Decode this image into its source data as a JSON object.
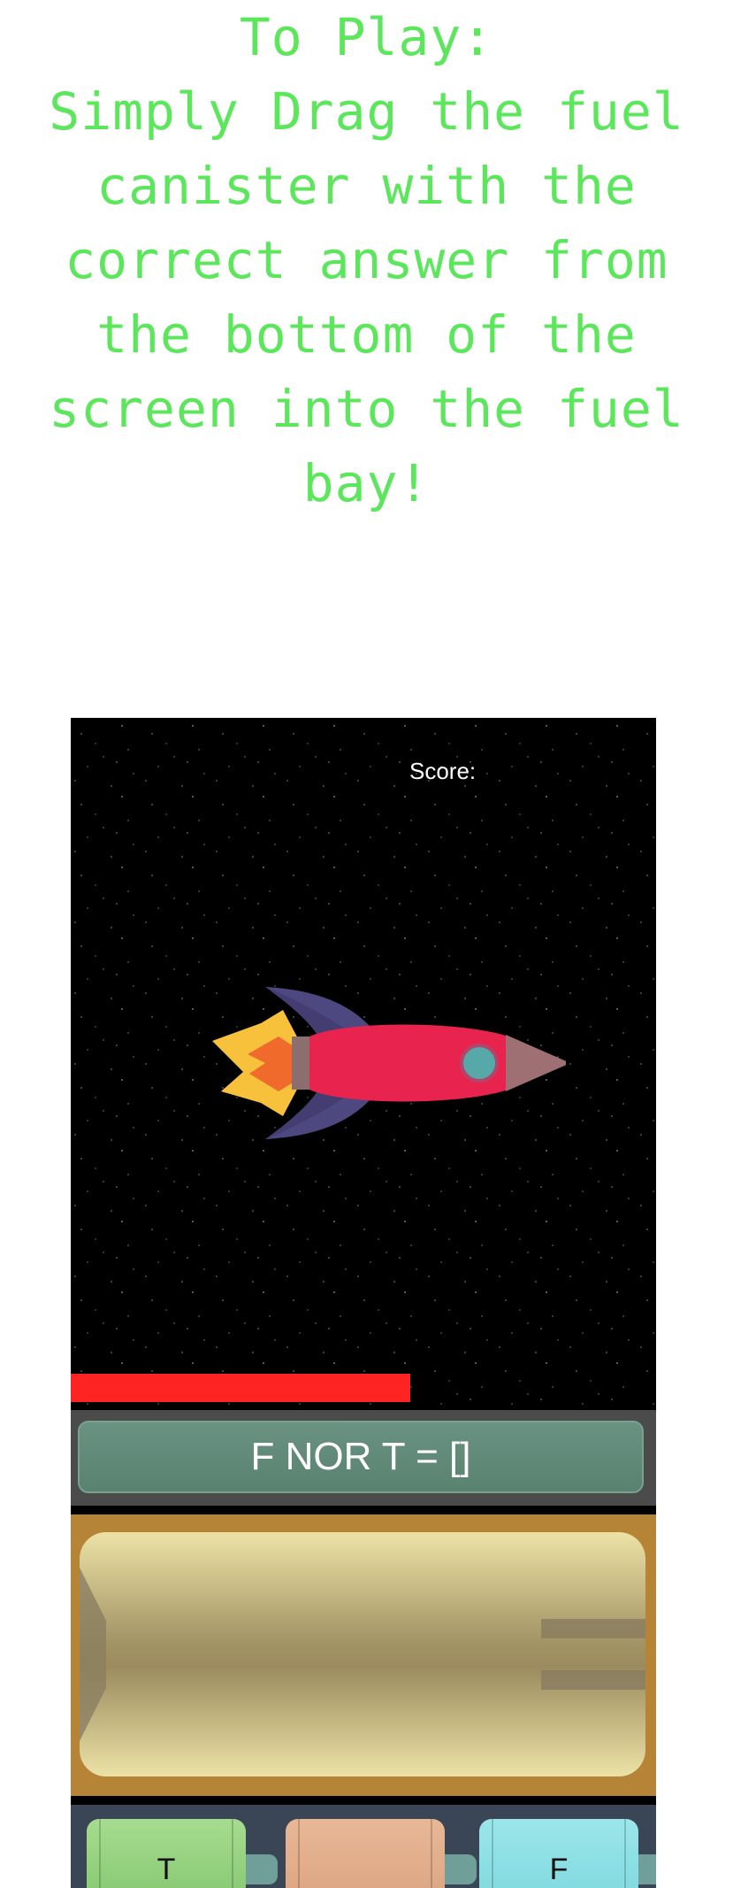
{
  "instructions": {
    "title": "To Play:",
    "lines": [
      "Simply Drag the fuel",
      "canister with the",
      "correct answer from",
      "the bottom of the",
      "screen into the fuel",
      "bay!"
    ]
  },
  "game": {
    "score_label": "Score:",
    "fuel_level": 0.58,
    "question": "F NOR T = []",
    "canisters": [
      {
        "label": "T",
        "color": "#8fd27a"
      },
      {
        "label": "",
        "color": "#e0aa86"
      },
      {
        "label": "F",
        "color": "#86dce2"
      }
    ]
  },
  "colors": {
    "instruction_text": "#5ce65c",
    "fuel_bar": "#ff2424",
    "question_panel": "#5f8a78",
    "bay_frame": "#b58436"
  }
}
